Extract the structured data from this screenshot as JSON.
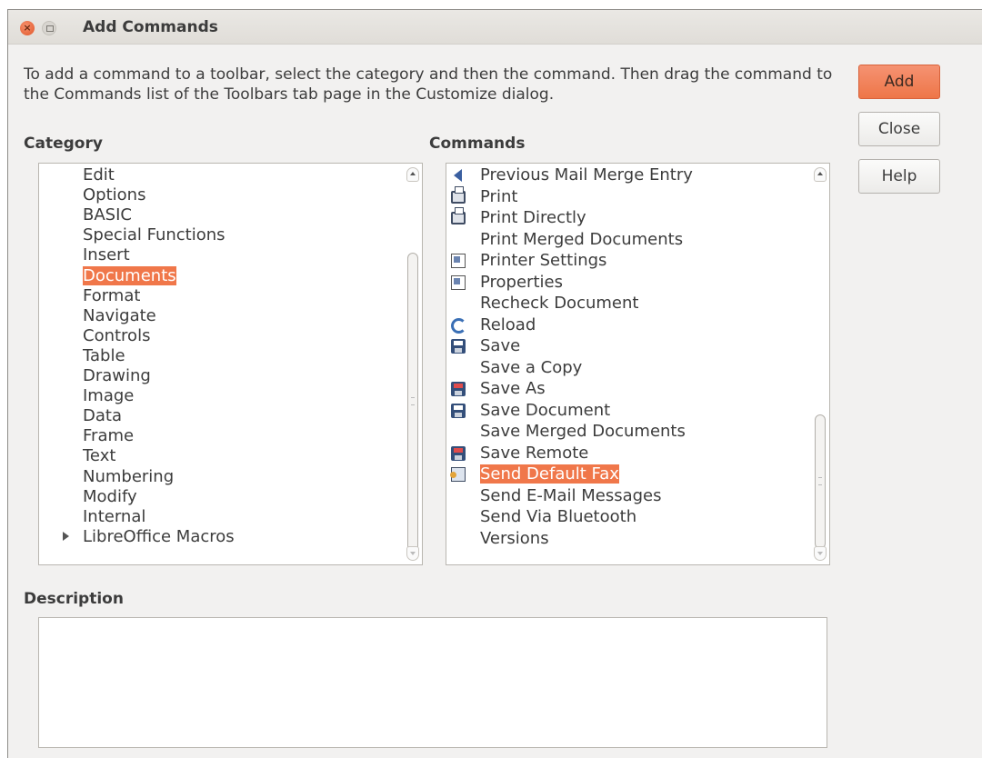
{
  "window": {
    "title": "Add Commands",
    "controls": {
      "close_icon": "close-icon",
      "maximize_icon": "maximize-icon",
      "close_glyph": "×"
    }
  },
  "intro_text": "To add a command to a toolbar, select the category and then the command. Then drag the command to the Commands list of the Toolbars tab page in the Customize dialog.",
  "buttons": {
    "add": "Add",
    "close": "Close",
    "help": "Help"
  },
  "category": {
    "label": "Category",
    "selected": "Documents",
    "items": [
      "Edit",
      "Options",
      "BASIC",
      "Special Functions",
      "Insert",
      "Documents",
      "Format",
      "Navigate",
      "Controls",
      "Table",
      "Drawing",
      "Image",
      "Data",
      "Frame",
      "Text",
      "Numbering",
      "Modify",
      "Internal",
      "LibreOffice Macros"
    ]
  },
  "commands": {
    "label": "Commands",
    "selected": "Send Default Fax",
    "items": [
      {
        "label": "Previous Mail Merge Entry",
        "icon": "previous-entry-icon"
      },
      {
        "label": "Print",
        "icon": "printer-icon"
      },
      {
        "label": "Print Directly",
        "icon": "print-directly-icon"
      },
      {
        "label": "Print Merged Documents",
        "icon": ""
      },
      {
        "label": "Printer Settings",
        "icon": "printer-settings-icon"
      },
      {
        "label": "Properties",
        "icon": "properties-icon"
      },
      {
        "label": "Recheck Document",
        "icon": ""
      },
      {
        "label": "Reload",
        "icon": "reload-icon"
      },
      {
        "label": "Save",
        "icon": "save-icon"
      },
      {
        "label": "Save a Copy",
        "icon": ""
      },
      {
        "label": "Save As",
        "icon": "save-as-icon"
      },
      {
        "label": "Save Document",
        "icon": "save-document-icon"
      },
      {
        "label": "Save Merged Documents",
        "icon": ""
      },
      {
        "label": "Save Remote",
        "icon": "save-remote-icon"
      },
      {
        "label": "Send Default Fax",
        "icon": "fax-icon"
      },
      {
        "label": "Send E-Mail Messages",
        "icon": ""
      },
      {
        "label": "Send Via Bluetooth",
        "icon": ""
      },
      {
        "label": "Versions",
        "icon": ""
      }
    ]
  },
  "description": {
    "label": "Description",
    "text": ""
  },
  "colors": {
    "accent": "#f0774a",
    "window_bg": "#f2f1f0"
  }
}
